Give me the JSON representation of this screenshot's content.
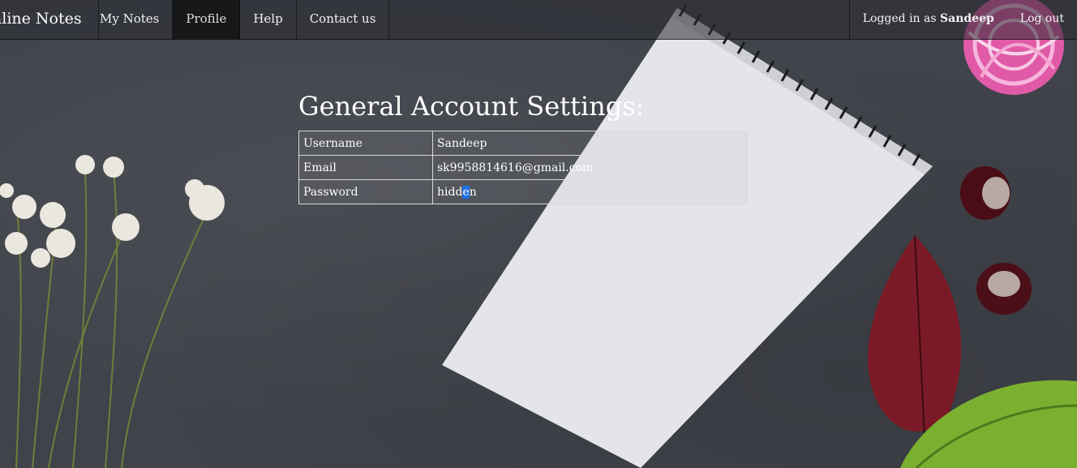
{
  "navbar": {
    "brand": "nline Notes",
    "links": [
      {
        "label": "My Notes",
        "active": false
      },
      {
        "label": "Profile",
        "active": true
      },
      {
        "label": "Help",
        "active": false
      },
      {
        "label": "Contact us",
        "active": false
      }
    ],
    "logged_in_prefix": "Logged in as ",
    "username": "Sandeep",
    "logout_label": "Log out"
  },
  "settings": {
    "title": "General Account Settings:",
    "rows": [
      {
        "label": "Username",
        "value": "Sandeep"
      },
      {
        "label": "Email",
        "value": "sk9958814616@gmail.com"
      },
      {
        "label": "Password",
        "value_a": "hidd",
        "value_b": "e",
        "value_c": "n"
      }
    ]
  }
}
